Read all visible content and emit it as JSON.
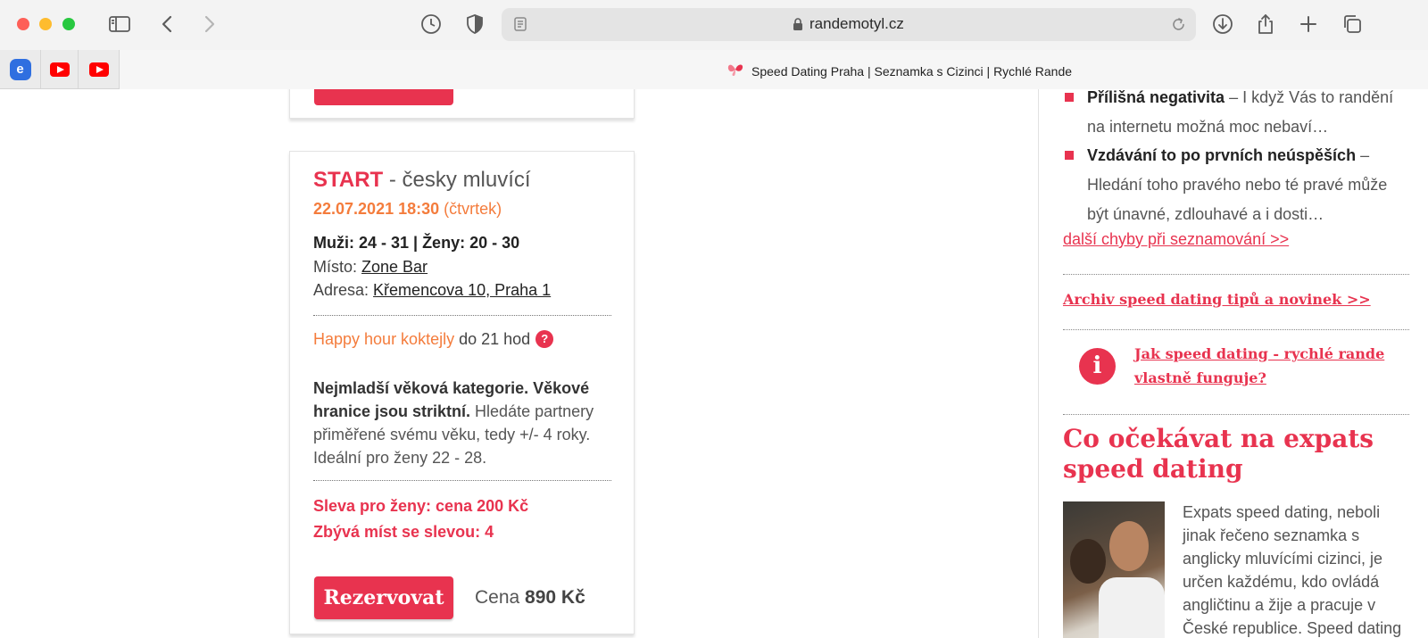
{
  "browser": {
    "url": "randemotyl.cz",
    "active_tab_title": "Speed Dating Praha | Seznamka s Cizinci | Rychlé Rande",
    "pinned_tabs": [
      "elephant-app-icon",
      "youtube-icon",
      "youtube-icon"
    ],
    "accent_colors": {
      "youtube": "#ff0000"
    }
  },
  "event": {
    "title_start": "START",
    "title_rest": " - česky mluvící",
    "date": "22.07.2021 18:30",
    "day": "(čtvrtek)",
    "ages": "Muži: 24 - 31 | Ženy: 20 - 30",
    "place_label": "Místo: ",
    "place_value": "Zone Bar",
    "address_label": "Adresa: ",
    "address_value": "Křemencova 10, Praha 1",
    "happy_hour_link": "Happy hour koktejly",
    "happy_hour_rest": " do 21 hod",
    "help_mark": "?",
    "desc_bold": "Nejmladší věková kategorie. Věkové hranice jsou striktní.",
    "desc_rest": " Hledáte partnery přiměřené svému věku, tedy +/- 4 roky. Ideální pro ženy 22 - 28.",
    "discount_line1": "Sleva pro ženy: cena 200 Kč",
    "discount_line2": "Zbývá míst se slevou: 4",
    "reserve_label": "Rezervovat",
    "price_label": "Cena ",
    "price_value": "890 Kč"
  },
  "sidebar": {
    "mistakes": [
      {
        "title": "Přílišná negativita",
        "text": " – I když Vás to randění na internetu možná moc nebaví…"
      },
      {
        "title": "Vzdávání to po prvních neúspěších",
        "text": " – Hledání toho pravého nebo té pravé může být únavné, zdlouhavé a i dosti…"
      }
    ],
    "more_mistakes_link": "další chyby při seznamování >>",
    "archive_link": "Archiv speed dating tipů a novinek >>",
    "info_icon_glyph": "i",
    "howto_link": "Jak speed dating - rychlé rande vlastně funguje?",
    "heading": "Co očekávat na expats speed dating",
    "paragraph": "Expats speed dating, neboli jinak řečeno seznamka s anglicky mluvícími cizinci, je určen každému, kdo ovládá angličtinu a žije a pracuje v České republice. Speed dating"
  },
  "colors": {
    "brand_red": "#e8334f",
    "orange": "#f47c3c"
  }
}
